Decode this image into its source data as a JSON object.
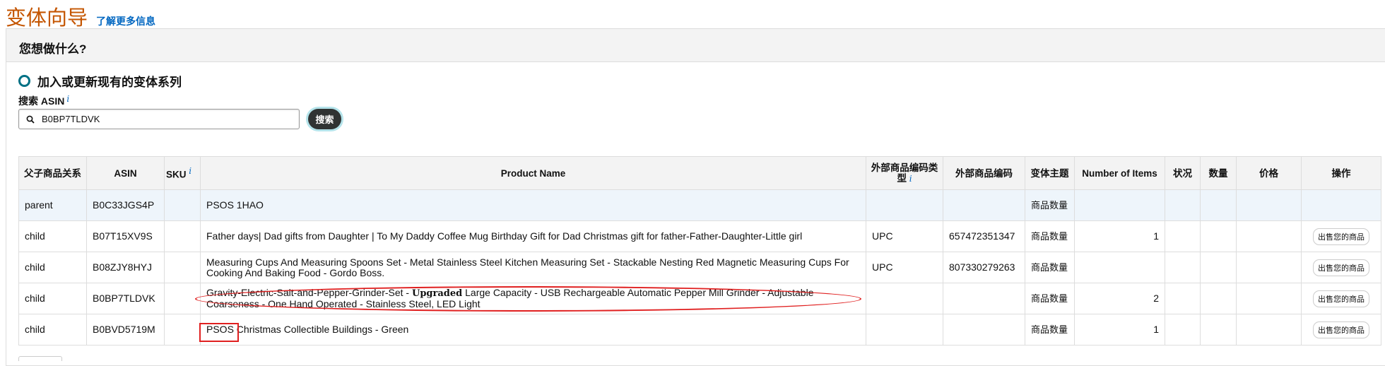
{
  "header": {
    "title": "变体向导",
    "learn_more": "了解更多信息"
  },
  "question": "您想做什么?",
  "option": {
    "label": "加入或更新现有的变体系列"
  },
  "search": {
    "label": "搜索 ASIN",
    "info": "i",
    "value": "B0BP7TLDVK",
    "button": "搜索"
  },
  "table": {
    "headers": {
      "relation": "父子商品关系",
      "asin": "ASIN",
      "sku": "SKU",
      "sku_info": "i",
      "product_name": "Product Name",
      "ext_type": "外部商品编码类型",
      "ext_type_info": "i",
      "ext_code": "外部商品编码",
      "theme": "变体主题",
      "items": "Number of Items",
      "condition": "状况",
      "quantity": "数量",
      "price": "价格",
      "action": "操作"
    },
    "rows": [
      {
        "relation": "parent",
        "asin": "B0C33JGS4P",
        "sku": "",
        "name": "PSOS 1HAO",
        "ext_type": "",
        "ext_code": "",
        "theme": "商品数量",
        "items": "",
        "action": ""
      },
      {
        "relation": "child",
        "asin": "B07T15XV9S",
        "sku": "",
        "name": "Father days| Dad gifts from Daughter | To My Daddy Coffee Mug Birthday Gift for Dad Christmas gift for father-Father-Daughter-Little girl",
        "ext_type": "UPC",
        "ext_code": "657472351347",
        "theme": "商品数量",
        "items": "1",
        "action": "出售您的商品"
      },
      {
        "relation": "child",
        "asin": "B08ZJY8HYJ",
        "sku": "",
        "name": "Measuring Cups And Measuring Spoons Set - Metal Stainless Steel Kitchen Measuring Set - Stackable Nesting Red Magnetic Measuring Cups For Cooking And Baking Food - Gordo Boss.",
        "ext_type": "UPC",
        "ext_code": "807330279263",
        "theme": "商品数量",
        "items": "",
        "action": "出售您的商品"
      },
      {
        "relation": "child",
        "asin": "B0BP7TLDVK",
        "sku": "",
        "name_pre": "Gravity-Electric-Salt-and-Pepper-Grinder-Set - ",
        "name_bold": "Upgraded",
        "name_post": " Large Capacity - USB Rechargeable Automatic Pepper Mill Grinder - Adjustable Coarseness - One Hand Operated - Stainless Steel, LED Light",
        "ext_type": "",
        "ext_code": "",
        "theme": "商品数量",
        "items": "2",
        "action": "出售您的商品"
      },
      {
        "relation": "child",
        "asin": "B0BVD5719M",
        "sku": "",
        "name": "PSOS Christmas Collectible Buildings - Green",
        "ext_type": "",
        "ext_code": "",
        "theme": "商品数量",
        "items": "1",
        "action": "出售您的商品"
      }
    ]
  },
  "colors": {
    "title": "#c45500",
    "link": "#0066c0",
    "annotation": "#e02020",
    "radio": "#007185"
  }
}
